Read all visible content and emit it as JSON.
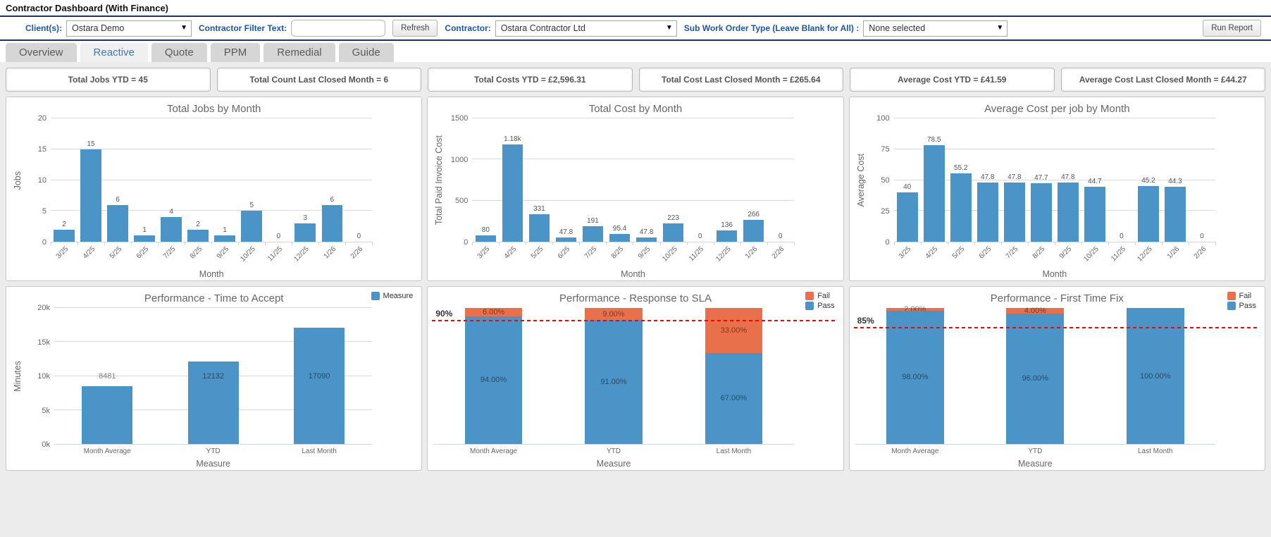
{
  "header": {
    "title": "Contractor Dashboard (With Finance)"
  },
  "filter": {
    "client_label": "Client(s):",
    "client_value": "Ostara Demo",
    "filter_text_label": "Contractor Filter Text:",
    "filter_text_value": "",
    "refresh_label": "Refresh",
    "contractor_label": "Contractor:",
    "contractor_value": "Ostara Contractor Ltd",
    "subwo_label": "Sub Work Order Type (Leave Blank for All) :",
    "subwo_value": "None selected",
    "run_report_label": "Run Report",
    "dropdown_caret": "▼"
  },
  "tabs": [
    {
      "label": "Overview",
      "active": false
    },
    {
      "label": "Reactive",
      "active": true
    },
    {
      "label": "Quote",
      "active": false
    },
    {
      "label": "PPM",
      "active": false
    },
    {
      "label": "Remedial",
      "active": false
    },
    {
      "label": "Guide",
      "active": false
    }
  ],
  "kpis": [
    "Total Jobs YTD = 45",
    "Total Count Last Closed Month = 6",
    "Total Costs YTD = £2,596.31",
    "Total Cost Last Closed Month = £265.64",
    "Average Cost YTD = £41.59",
    "Average Cost Last Closed Month = £44.27"
  ],
  "colors": {
    "bar_blue": "#4b94c8",
    "fail_orange": "#e8714b",
    "threshold_red": "#ff0000",
    "gridline": "#d9d9d9",
    "axis_line": "#ccd6eb"
  },
  "chart_data": [
    {
      "id": "total-jobs-by-month",
      "type": "bar",
      "title": "Total Jobs by Month",
      "categories": [
        "3/25",
        "4/25",
        "5/25",
        "6/25",
        "7/25",
        "8/25",
        "9/25",
        "10/25",
        "11/25",
        "12/25",
        "1/26",
        "2/26"
      ],
      "values": [
        2,
        15,
        6,
        1,
        4,
        2,
        1,
        5,
        0,
        3,
        6,
        0
      ],
      "value_labels": [
        "2",
        "15",
        "6",
        "1",
        "4",
        "2",
        "1",
        "5",
        "0",
        "3",
        "6",
        "0"
      ],
      "xlabel": "Month",
      "ylabel": "Jobs",
      "ylim": [
        0,
        20
      ],
      "yticks": [
        0,
        5,
        10,
        15,
        20
      ],
      "ytick_labels": [
        "0",
        "5",
        "10",
        "15",
        "20"
      ],
      "grid": true,
      "rotated_xticks": true,
      "label_position": "above"
    },
    {
      "id": "total-cost-by-month",
      "type": "bar",
      "title": "Total Cost by Month",
      "categories": [
        "3/25",
        "4/25",
        "5/25",
        "6/25",
        "7/25",
        "8/25",
        "9/25",
        "10/25",
        "11/25",
        "12/25",
        "1/26",
        "2/26"
      ],
      "values": [
        80,
        1180,
        331,
        47.8,
        191,
        95.4,
        47.8,
        223,
        0,
        136,
        266,
        0
      ],
      "value_labels": [
        "80",
        "1.18k",
        "331",
        "47.8",
        "191",
        "95.4",
        "47.8",
        "223",
        "0",
        "136",
        "266",
        "0"
      ],
      "xlabel": "Month",
      "ylabel": "Total Paid Invoice Cost",
      "ylim": [
        0,
        1500
      ],
      "yticks": [
        0,
        500,
        1000,
        1500
      ],
      "ytick_labels": [
        "0",
        "500",
        "1000",
        "1500"
      ],
      "grid": true,
      "rotated_xticks": true,
      "label_position": "above"
    },
    {
      "id": "average-cost-per-job-by-month",
      "type": "bar",
      "title": "Average Cost per job by Month",
      "categories": [
        "3/25",
        "4/25",
        "5/25",
        "6/25",
        "7/25",
        "8/25",
        "9/25",
        "10/25",
        "11/25",
        "12/25",
        "1/26",
        "2/26"
      ],
      "values": [
        40,
        78.5,
        55.2,
        47.8,
        47.8,
        47.7,
        47.8,
        44.7,
        0,
        45.2,
        44.3,
        0
      ],
      "value_labels": [
        "40",
        "78.5",
        "55.2",
        "47.8",
        "47.8",
        "47.7",
        "47.8",
        "44.7",
        "0",
        "45.2",
        "44.3",
        "0"
      ],
      "xlabel": "Month",
      "ylabel": "Average Cost",
      "ylim": [
        0,
        100
      ],
      "yticks": [
        0,
        25,
        50,
        75,
        100
      ],
      "ytick_labels": [
        "0",
        "25",
        "50",
        "75",
        "100"
      ],
      "grid": true,
      "rotated_xticks": true,
      "label_position": "above"
    },
    {
      "id": "performance-time-to-accept",
      "type": "bar",
      "title": "Performance - Time to Accept",
      "categories": [
        "Month Average",
        "YTD",
        "Last Month"
      ],
      "values": [
        8481,
        12132,
        17090
      ],
      "value_labels": [
        "8481",
        "12132",
        "17090"
      ],
      "xlabel": "Measure",
      "ylabel": "Minutes",
      "ylim": [
        0,
        20000
      ],
      "yticks": [
        0,
        5000,
        10000,
        15000,
        20000
      ],
      "ytick_labels": [
        "0k",
        "5k",
        "10k",
        "15k",
        "20k"
      ],
      "grid": true,
      "rotated_xticks": false,
      "label_position": "center",
      "legend": [
        {
          "name": "Measure",
          "color": "blue"
        }
      ]
    },
    {
      "id": "performance-response-to-sla",
      "type": "stacked_bar",
      "title": "Performance - Response to SLA",
      "categories": [
        "Month Average",
        "YTD",
        "Last Month"
      ],
      "series": [
        {
          "name": "Fail",
          "color": "orange",
          "values": [
            6,
            9,
            33
          ],
          "labels": [
            "6.00%",
            "9.00%",
            "33.00%"
          ]
        },
        {
          "name": "Pass",
          "color": "blue",
          "values": [
            94,
            91,
            67
          ],
          "labels": [
            "94.00%",
            "91.00%",
            "67.00%"
          ]
        }
      ],
      "xlabel": "Measure",
      "ylabel": "",
      "ylim": [
        0,
        100
      ],
      "grid": false,
      "rotated_xticks": false,
      "threshold": {
        "value": 90,
        "label": "90%"
      },
      "legend": [
        {
          "name": "Fail",
          "color": "orange"
        },
        {
          "name": "Pass",
          "color": "blue"
        }
      ]
    },
    {
      "id": "performance-first-time-fix",
      "type": "stacked_bar",
      "title": "Performance - First Time Fix",
      "categories": [
        "Month Average",
        "YTD",
        "Last Month"
      ],
      "series": [
        {
          "name": "Fail",
          "color": "orange",
          "values": [
            2,
            4,
            0
          ],
          "labels": [
            "2.00%",
            "4.00%",
            ""
          ]
        },
        {
          "name": "Pass",
          "color": "blue",
          "values": [
            98,
            96,
            100
          ],
          "labels": [
            "98.00%",
            "96.00%",
            "100.00%"
          ]
        }
      ],
      "xlabel": "Measure",
      "ylabel": "",
      "ylim": [
        0,
        100
      ],
      "grid": false,
      "rotated_xticks": false,
      "threshold": {
        "value": 85,
        "label": "85%"
      },
      "legend": [
        {
          "name": "Fail",
          "color": "orange"
        },
        {
          "name": "Pass",
          "color": "blue"
        }
      ]
    }
  ]
}
